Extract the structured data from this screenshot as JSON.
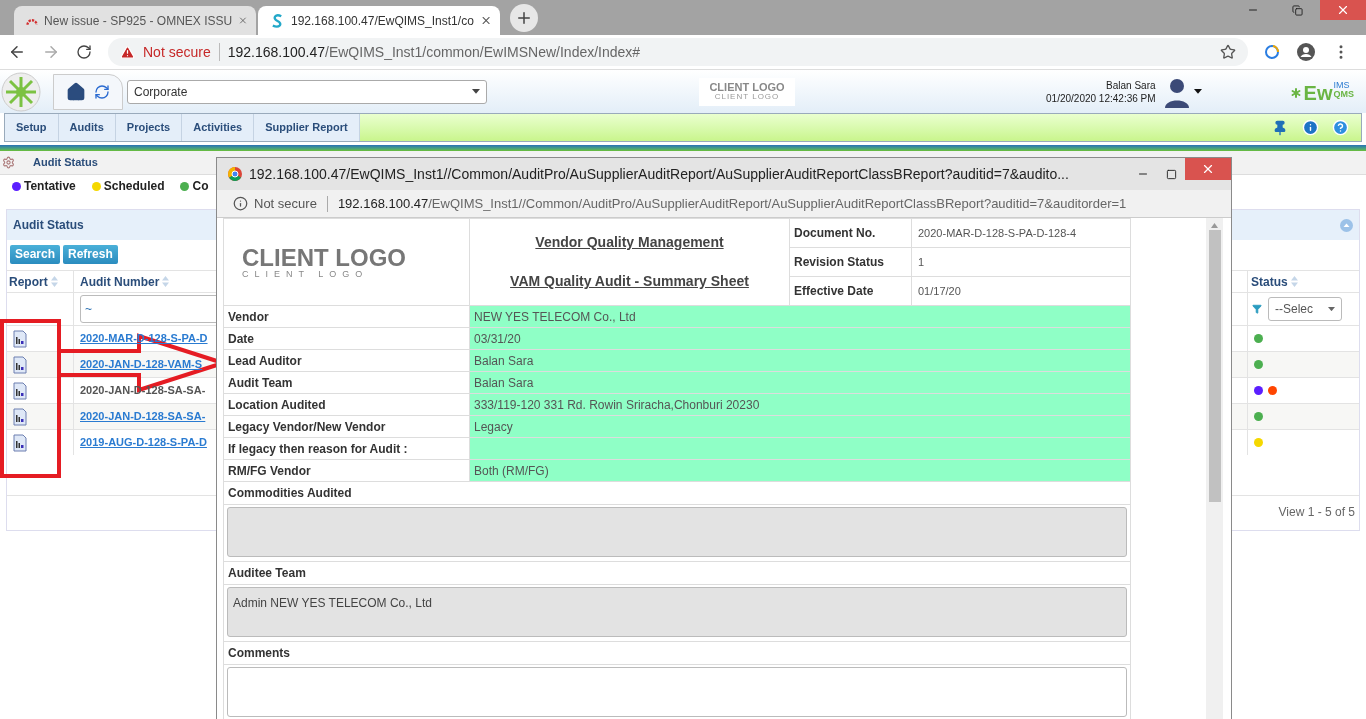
{
  "browser": {
    "tabs": [
      {
        "title": "New issue - SP925 - OMNEX ISSU",
        "selected": false
      },
      {
        "title": "192.168.100.47/EwQIMS_Inst1/co",
        "selected": true
      }
    ],
    "security": "Not secure",
    "url_host": "192.168.100.47",
    "url_path": "/EwQIMS_Inst1/common/EwIMSNew/Index/Index#"
  },
  "app_header": {
    "site": "Corporate",
    "client_logo": "CLIENT LOGO",
    "client_logo_sub": "CLIENT LOGO",
    "user_name": "Balan Sara",
    "datetime": "01/20/2020 12:42:36 PM",
    "brand_main": "Ew",
    "brand_sup": "IMS",
    "brand_sub": "QMS"
  },
  "menu": [
    {
      "label": "Setup"
    },
    {
      "label": "Audits"
    },
    {
      "label": "Projects"
    },
    {
      "label": "Activities"
    },
    {
      "label": "Supplier Report"
    }
  ],
  "breadcrumb": "Audit Status",
  "legend": [
    {
      "label": "Tentative",
      "color": "#5b1fff"
    },
    {
      "label": "Scheduled",
      "color": "#f5d800"
    },
    {
      "label": "Co",
      "color": "#4caf50"
    }
  ],
  "panel": {
    "title": "Audit Status",
    "buttons": [
      "Search",
      "Refresh"
    ],
    "columns": [
      {
        "label": "Report"
      },
      {
        "label": "Audit Number"
      },
      {
        "label": "Status"
      }
    ],
    "filter_value": "~",
    "status_filter": "--Selec",
    "rows": [
      {
        "audit_number": "2020-MAR-D-128-S-PA-D",
        "link": true,
        "statuses": [
          {
            "color": "#4caf50"
          }
        ]
      },
      {
        "audit_number": "2020-JAN-D-128-VAM-S",
        "link": true,
        "statuses": [
          {
            "color": "#4caf50"
          }
        ]
      },
      {
        "audit_number": "2020-JAN-D-128-SA-SA-",
        "link": false,
        "statuses": [
          {
            "color": "#5b1fff"
          },
          {
            "color": "#ff4500"
          }
        ]
      },
      {
        "audit_number": "2020-JAN-D-128-SA-SA-",
        "link": true,
        "statuses": [
          {
            "color": "#4caf50"
          }
        ]
      },
      {
        "audit_number": "2019-AUG-D-128-S-PA-D",
        "link": true,
        "statuses": [
          {
            "color": "#f5d800"
          }
        ]
      }
    ],
    "pager": "View 1 - 5 of 5"
  },
  "popup": {
    "title": "192.168.100.47/EwQIMS_Inst1//Common/AuditPro/AuSupplierAuditReport/AuSupplierAuditReportClassBReport?auditid=7&audito...",
    "security": "Not secure",
    "url_host": "192.168.100.47",
    "url_path": "/EwQIMS_Inst1//Common/AuditPro/AuSupplierAuditReport/AuSupplierAuditReportClassBReport?auditid=7&auditorder=1",
    "client_logo": "CLIENT LOGO",
    "client_logo_sub": "CLIENT LOGO",
    "titles": [
      "Vendor Quality Management",
      "VAM Quality Audit - Summary Sheet"
    ],
    "meta": [
      {
        "label": "Document No.",
        "value": "2020-MAR-D-128-S-PA-D-128-4"
      },
      {
        "label": "Revision Status",
        "value": "1"
      },
      {
        "label": "Effective Date",
        "value": "01/17/20"
      }
    ],
    "fields": [
      {
        "label": "Vendor",
        "value": "NEW YES TELECOM Co., Ltd"
      },
      {
        "label": "Date",
        "value": "03/31/20"
      },
      {
        "label": "Lead Auditor",
        "value": "Balan Sara"
      },
      {
        "label": "Audit Team",
        "value": "Balan Sara"
      },
      {
        "label": "Location Audited",
        "value": "333/119-120 331 Rd. Rowin Sriracha,Chonburi 20230"
      },
      {
        "label": "Legacy Vendor/New Vendor",
        "value": "Legacy"
      },
      {
        "label": "If legacy then reason for Audit :"
      },
      {
        "label": "RM/FG Vendor",
        "value": "Both (RM/FG)"
      }
    ],
    "text_areas": [
      {
        "label": "Commodities Audited"
      },
      {
        "label": "Auditee Team",
        "value": "Admin NEW YES TELECOM Co., Ltd"
      },
      {
        "label": "Comments"
      }
    ]
  }
}
